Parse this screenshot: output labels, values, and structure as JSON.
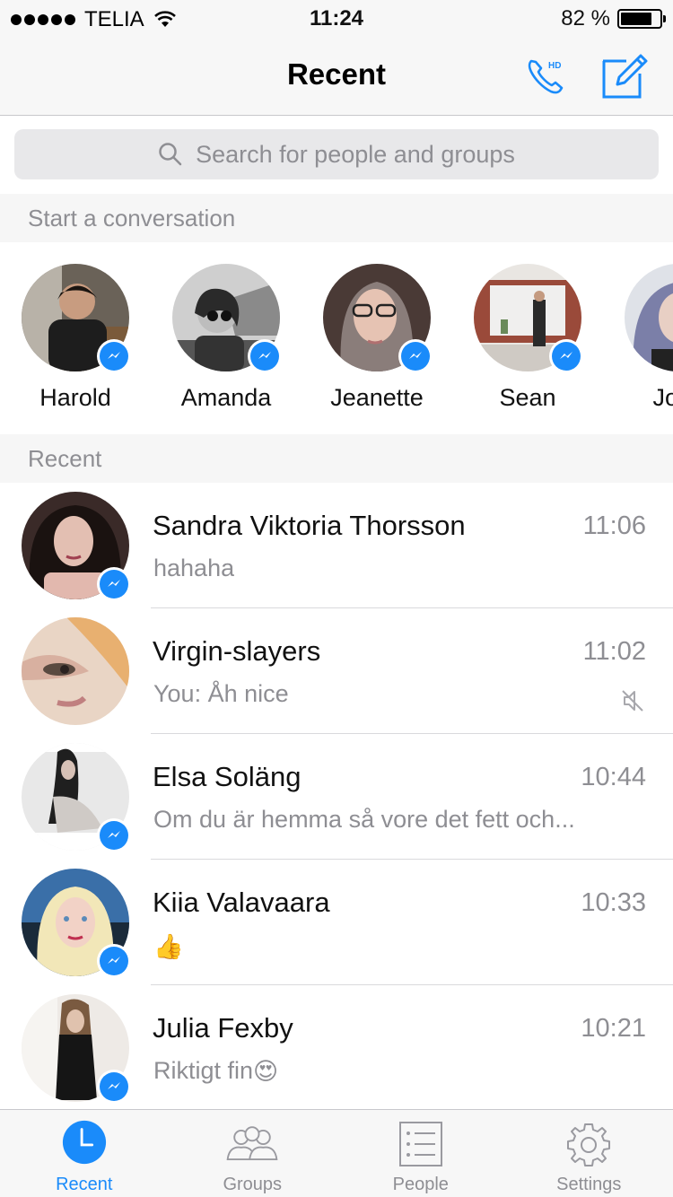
{
  "status_bar": {
    "carrier": "TELIA",
    "time": "11:24",
    "battery_percent": "82 %",
    "battery_level": 0.82
  },
  "nav": {
    "title": "Recent",
    "call_icon": "hd-phone-icon",
    "compose_icon": "compose-icon"
  },
  "search": {
    "placeholder": "Search for people and groups"
  },
  "sections": {
    "start_conversation": "Start a conversation",
    "recent": "Recent"
  },
  "suggested": [
    {
      "name": "Harold"
    },
    {
      "name": "Amanda"
    },
    {
      "name": "Jeanette"
    },
    {
      "name": "Sean"
    },
    {
      "name": "Jose"
    }
  ],
  "conversations": [
    {
      "name": "Sandra Viktoria Thorsson",
      "time": "11:06",
      "message": "hahaha",
      "badge": true,
      "muted": false
    },
    {
      "name": "Virgin-slayers",
      "time": "11:02",
      "message": "You: Åh nice",
      "badge": false,
      "muted": true
    },
    {
      "name": "Elsa Soläng",
      "time": "10:44",
      "message": "Om du är hemma så vore det fett och...",
      "badge": true,
      "muted": false
    },
    {
      "name": "Kiia Valavaara",
      "time": "10:33",
      "message": "",
      "emoji": "👍",
      "badge": true,
      "muted": false
    },
    {
      "name": "Julia Fexby",
      "time": "10:21",
      "message": "Riktigt fin",
      "emoji": "😍",
      "badge": true,
      "muted": false
    }
  ],
  "tabs": [
    {
      "label": "Recent",
      "icon": "clock-icon",
      "active": true
    },
    {
      "label": "Groups",
      "icon": "groups-icon",
      "active": false
    },
    {
      "label": "People",
      "icon": "list-icon",
      "active": false
    },
    {
      "label": "Settings",
      "icon": "gear-icon",
      "active": false
    }
  ],
  "colors": {
    "accent": "#1a8bfa",
    "secondary_text": "#8e8e93"
  }
}
